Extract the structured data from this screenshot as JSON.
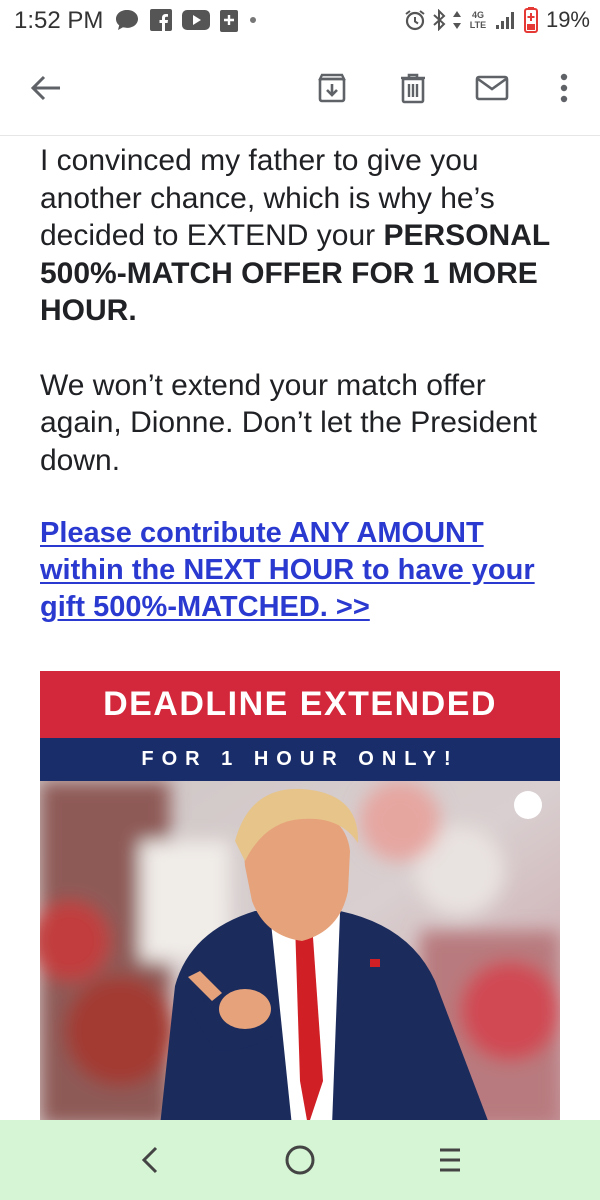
{
  "status_bar": {
    "time": "1:52 PM",
    "network": "4G LTE",
    "battery": "19%",
    "left_icons": [
      "chat-bubble-icon",
      "facebook-icon",
      "youtube-icon",
      "news-icon",
      "dot-icon"
    ],
    "right_icons": [
      "alarm-icon",
      "bluetooth-icon",
      "data-arrows-icon",
      "signal-icon",
      "battery-icon"
    ]
  },
  "toolbar": {
    "icons": [
      "back-arrow-icon",
      "archive-icon",
      "delete-icon",
      "mail-icon",
      "more-vert-icon"
    ]
  },
  "email": {
    "para1_normal": "I convinced my father to give you another chance, which is why he’s decided to EXTEND your ",
    "para1_bold": "PERSONAL 500%-MATCH OFFER FOR 1 MORE HOUR.",
    "para2": "We won’t extend your match offer again, Dionne. Don’t let the President down.",
    "link": "Please contribute ANY AMOUNT within the NEXT HOUR to have your gift 500%-MATCHED. >>"
  },
  "banner": {
    "headline": "DEADLINE EXTENDED",
    "subline": "FOR 1 HOUR ONLY!",
    "colors": {
      "red": "#d3283b",
      "navy": "#1a2d6b"
    }
  },
  "nav_bar": {
    "icons": [
      "nav-back-icon",
      "nav-home-icon",
      "nav-recents-icon"
    ],
    "background": "#d6f5d4"
  },
  "colors": {
    "link": "#2a3ad0",
    "text": "#202124"
  }
}
